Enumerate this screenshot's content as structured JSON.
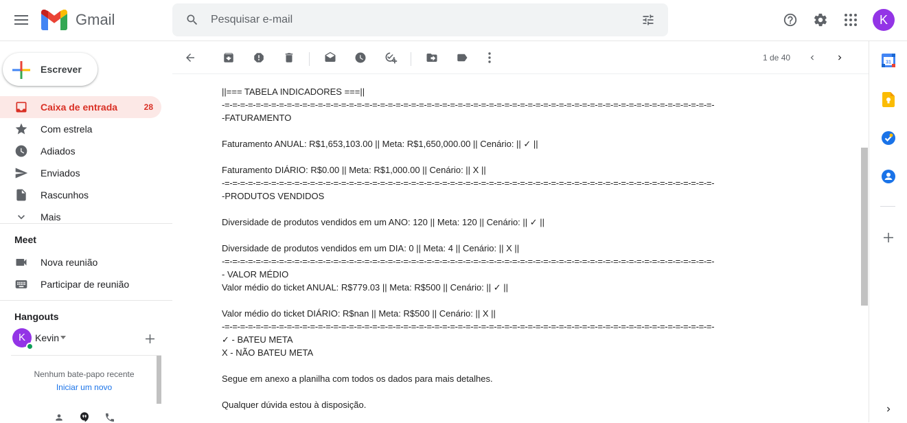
{
  "app": {
    "name": "Gmail"
  },
  "search": {
    "placeholder": "Pesquisar e-mail"
  },
  "user": {
    "avatar_letter": "K"
  },
  "compose": {
    "label": "Escrever"
  },
  "nav": {
    "items": [
      {
        "label": "Caixa de entrada",
        "count": "28"
      },
      {
        "label": "Com estrela"
      },
      {
        "label": "Adiados"
      },
      {
        "label": "Enviados"
      },
      {
        "label": "Rascunhos"
      },
      {
        "label": "Mais"
      }
    ]
  },
  "meet": {
    "title": "Meet",
    "new_meeting": "Nova reunião",
    "join_meeting": "Participar de reunião"
  },
  "hangouts": {
    "title": "Hangouts",
    "user_name": "Kevin",
    "user_letter": "K",
    "empty_text": "Nenhum bate-papo recente",
    "start_new": "Iniciar um novo"
  },
  "toolbar": {
    "pagination": "1 de 40"
  },
  "message": {
    "lines": [
      "||=== TABELA INDICADORES ===||",
      "-=-=-=-=-=-=-=-=-=-=-=-=-=-=-=-=-=-=-=-=-=-=-=-=-=-=-=-=-=-=-=-=-=-=-=-=-=-=-=-=-=-=-=-=-=-=-=-=-=-=-=-=-=-=-=-=-=-=-=-=-=-=-=-",
      "-FATURAMENTO",
      "",
      "Faturamento ANUAL: R$1,653,103.00 || Meta: R$1,650,000.00 || Cenário: || ✓ ||",
      "",
      "Faturamento DIÁRIO: R$0.00 || Meta: R$1,000.00 || Cenário: || X ||",
      "-=-=-=-=-=-=-=-=-=-=-=-=-=-=-=-=-=-=-=-=-=-=-=-=-=-=-=-=-=-=-=-=-=-=-=-=-=-=-=-=-=-=-=-=-=-=-=-=-=-=-=-=-=-=-=-=-=-=-=-=-=-=-=-",
      "-PRODUTOS VENDIDOS",
      "",
      "Diversidade de produtos vendidos em um ANO: 120 || Meta: 120 || Cenário: || ✓ ||",
      "",
      "Diversidade de produtos vendidos em um DIA: 0 || Meta: 4 || Cenário: || X ||",
      "-=-=-=-=-=-=-=-=-=-=-=-=-=-=-=-=-=-=-=-=-=-=-=-=-=-=-=-=-=-=-=-=-=-=-=-=-=-=-=-=-=-=-=-=-=-=-=-=-=-=-=-=-=-=-=-=-=-=-=-=-=-=-=-",
      "- VALOR MÉDIO",
      "Valor médio do ticket ANUAL: R$779.03 || Meta: R$500 || Cenário: || ✓ ||",
      "",
      "Valor médio do ticket DIÁRIO: R$nan || Meta: R$500 || Cenário: || X ||",
      "-=-=-=-=-=-=-=-=-=-=-=-=-=-=-=-=-=-=-=-=-=-=-=-=-=-=-=-=-=-=-=-=-=-=-=-=-=-=-=-=-=-=-=-=-=-=-=-=-=-=-=-=-=-=-=-=-=-=-=-=-=-=-=-",
      "✓ - BATEU META",
      "X - NÃO BATEU META",
      "",
      "Segue em anexo a planilha com todos os dados para mais detalhes.",
      "",
      "Qualquer dúvida estou à disposição."
    ]
  },
  "icons": {
    "menu": "menu-icon",
    "search": "search-icon",
    "filter": "tune-icon",
    "help": "help-icon",
    "settings": "gear-icon",
    "apps": "apps-grid-icon",
    "back": "arrow-back-icon",
    "archive": "archive-icon",
    "spam": "report-spam-icon",
    "delete": "trash-icon",
    "unread": "mark-unread-icon",
    "snooze": "clock-icon",
    "task": "add-task-icon",
    "move": "move-to-icon",
    "label": "label-icon",
    "more": "more-vert-icon"
  },
  "colors": {
    "accent_red": "#d93025",
    "avatar_purple": "#9334e6",
    "link_blue": "#1a73e8",
    "active_bg": "#fce8e6"
  }
}
